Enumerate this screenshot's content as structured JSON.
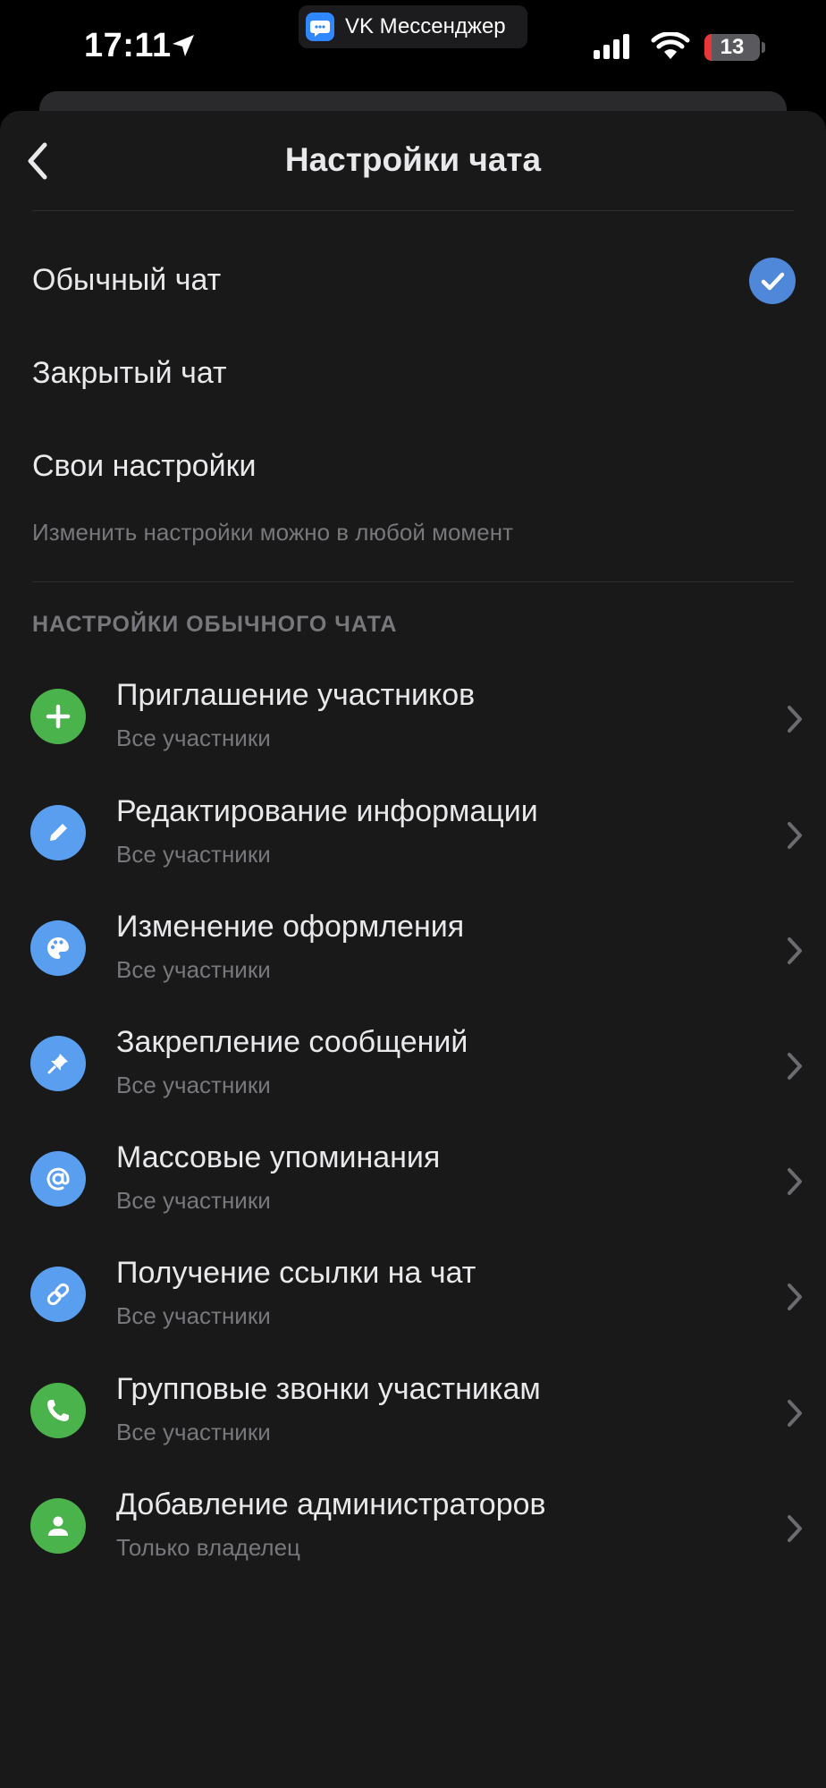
{
  "status_bar": {
    "time": "17:11",
    "app_name": "VK Мессенджер",
    "battery_level": "13",
    "battery_fraction": 0.13
  },
  "header": {
    "title": "Настройки чата"
  },
  "chat_types": [
    {
      "label": "Обычный чат",
      "selected": true
    },
    {
      "label": "Закрытый чат",
      "selected": false
    },
    {
      "label": "Свои настройки",
      "selected": false
    }
  ],
  "chat_types_hint": "Изменить настройки можно в любой момент",
  "section_title": "НАСТРОЙКИ ОБЫЧНОГО ЧАТА",
  "permissions": [
    {
      "title": "Приглашение участников",
      "value": "Все участники",
      "icon": "plus-icon",
      "color": "green"
    },
    {
      "title": "Редактирование информации",
      "value": "Все участники",
      "icon": "pencil-icon",
      "color": "blue"
    },
    {
      "title": "Изменение оформления",
      "value": "Все участники",
      "icon": "palette-icon",
      "color": "blue"
    },
    {
      "title": "Закрепление сообщений",
      "value": "Все участники",
      "icon": "pin-icon",
      "color": "blue"
    },
    {
      "title": "Массовые упоминания",
      "value": "Все участники",
      "icon": "at-sign-icon",
      "color": "blue"
    },
    {
      "title": "Получение ссылки на чат",
      "value": "Все участники",
      "icon": "link-icon",
      "color": "blue"
    },
    {
      "title": "Групповые звонки участникам",
      "value": "Все участники",
      "icon": "phone-icon",
      "color": "green"
    },
    {
      "title": "Добавление администраторов",
      "value": "Только владелец",
      "icon": "user-icon",
      "color": "green"
    }
  ],
  "colors": {
    "background": "#19191a",
    "accent_blue": "#5a9ef0",
    "check_blue": "#4f87d9",
    "accent_green": "#4bb34b",
    "text_primary": "#e9e9ec",
    "text_secondary": "#77777c"
  }
}
